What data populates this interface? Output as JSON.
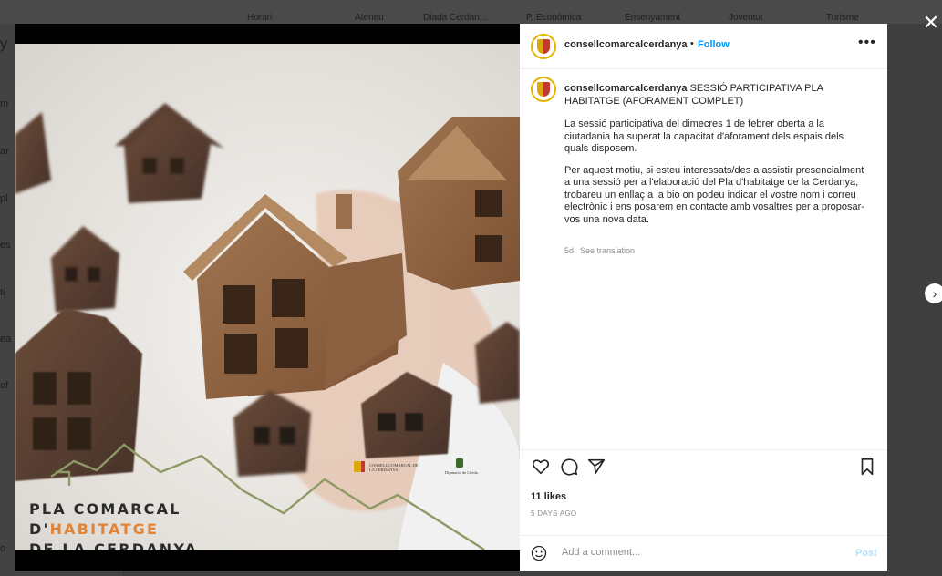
{
  "background": {
    "nav_items": [
      "Horari",
      "Ateneu",
      "Diada Cerdan...",
      "P. Econòmica",
      "Ensenyament",
      "Joventut",
      "Turisme"
    ],
    "left_fragments": [
      "y",
      "m",
      "ar",
      "pl",
      "es",
      "ti",
      "ea",
      "of",
      "o"
    ]
  },
  "post": {
    "username": "consellcomarcalcerdanya",
    "separator": "•",
    "follow_label": "Follow",
    "more_label": "•••",
    "caption_title": "SESSIÓ PARTICIPATIVA PLA HABITATGE (AFORAMENT COMPLET)",
    "caption_p1": "La sessió participativa del dimecres 1 de febrer oberta a la ciutadania ha superat la capacitat d'aforament dels espais dels quals disposem.",
    "caption_p2": "Per aquest motiu, si esteu interessats/des a assistir presencialment a una sessió per a l'elaboració del Pla d'habitatge de la Cerdanya, trobareu un enllaç a la bio on podeu indicar el vostre nom i correu electrònic i ens posarem en contacte amb vosaltres per a proposar-vos una nova data.",
    "age_short": "5d",
    "see_translation": "See translation",
    "likes": "11 likes",
    "time_ago": "5 DAYS AGO",
    "comment_placeholder": "Add a comment...",
    "post_label": "Post"
  },
  "artwork": {
    "line1": "PLA COMARCAL",
    "line2_a": "D'",
    "line2_b": "HABITATGE",
    "line3": "DE LA CERDANYA",
    "logo1": "CONSELL COMARCAL DE LA CERDANYA",
    "logo2": "Diputació de Lleida"
  },
  "icons": {
    "close": "close-icon",
    "next": "chevron-right-icon",
    "like": "heart-icon",
    "comment": "comment-icon",
    "share": "paper-plane-icon",
    "save": "bookmark-icon",
    "emoji": "smiley-icon"
  },
  "colors": {
    "follow": "#0095f6",
    "accent_orange": "#e0843a",
    "post_disabled": "#b2dffc",
    "avatar_ring": "#e3b300"
  }
}
